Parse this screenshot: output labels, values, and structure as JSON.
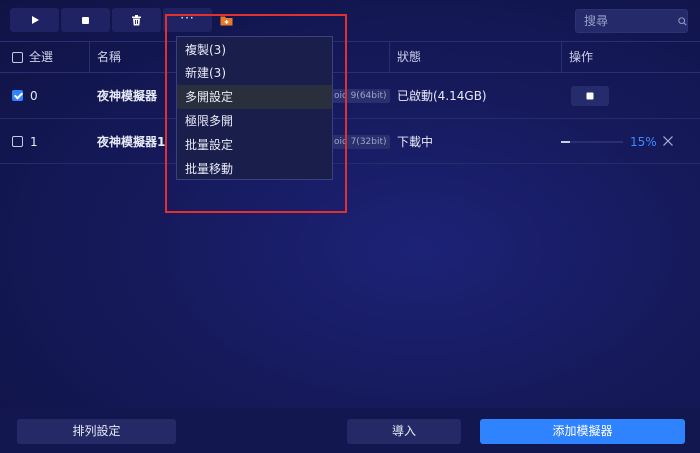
{
  "colors": {
    "accent": "#2f83ff",
    "folder_icon": "#e87a2a",
    "highlight": "#e03030",
    "progress_text": "#3a8cff"
  },
  "toolbar": {
    "buttons": [
      {
        "icon": "play-icon"
      },
      {
        "icon": "stop-icon"
      },
      {
        "icon": "trash-icon"
      },
      {
        "icon": "more-icon",
        "label": "···"
      },
      {
        "icon": "folder-add-icon"
      }
    ],
    "search": {
      "placeholder": "搜尋",
      "value": "",
      "icon": "search-icon"
    }
  },
  "table": {
    "headers": {
      "select_all": "全選",
      "name": "名稱",
      "status": "狀態",
      "action": "操作"
    },
    "rows": [
      {
        "index": "0",
        "name": "夜神模擬器",
        "tag": "oid 9(64bit)",
        "status": "已啟動(4.14GB)",
        "checked": true
      },
      {
        "index": "1",
        "name": "夜神模擬器1",
        "tag": "oid 7(32bit)",
        "status": "下載中",
        "checked": false,
        "progress_text": "15%",
        "progress": 0.15
      }
    ]
  },
  "menu": {
    "items": [
      "複製(3)",
      "新建(3)",
      "多開設定",
      "極限多開",
      "批量設定",
      "批量移動"
    ]
  },
  "bottom": {
    "sort_label": "排列設定",
    "import_label": "導入",
    "add_label": "添加模擬器"
  }
}
